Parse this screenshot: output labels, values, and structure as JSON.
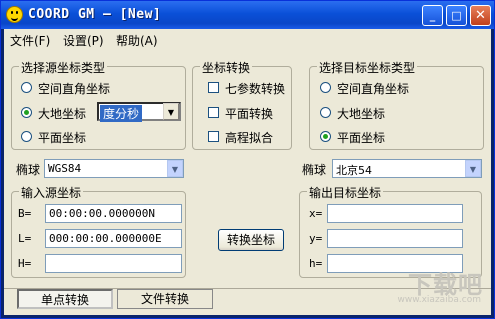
{
  "window": {
    "title": "COORD GM — [New]",
    "controls": {
      "minimize": "_",
      "maximize": "□",
      "close": "✕"
    }
  },
  "menu": [
    "文件(F)",
    "设置(P)",
    "帮助(A)"
  ],
  "source_type_group": {
    "title": "选择源坐标类型",
    "options": [
      "空间直角坐标",
      "大地坐标",
      "平面坐标"
    ],
    "selected": "大地坐标",
    "format_select": {
      "value": "度分秒"
    }
  },
  "transform_group": {
    "title": "坐标转换",
    "options": [
      "七参数转换",
      "平面转换",
      "高程拟合"
    ]
  },
  "target_type_group": {
    "title": "选择目标坐标类型",
    "options": [
      "空间直角坐标",
      "大地坐标",
      "平面坐标"
    ],
    "selected": "平面坐标"
  },
  "source_ellipsoid": {
    "label": "椭球",
    "value": "WGS84"
  },
  "target_ellipsoid": {
    "label": "椭球",
    "value": "北京54"
  },
  "input_group": {
    "title": "输入源坐标",
    "fields": [
      {
        "label": "B=",
        "value": "00:00:00.000000N"
      },
      {
        "label": "L=",
        "value": "000:00:00.000000E"
      },
      {
        "label": "H=",
        "value": ""
      }
    ]
  },
  "output_group": {
    "title": "输出目标坐标",
    "fields": [
      {
        "label": "x=",
        "value": ""
      },
      {
        "label": "y=",
        "value": ""
      },
      {
        "label": "h=",
        "value": ""
      }
    ]
  },
  "convert_button": "转换坐标",
  "mode_tabs": [
    "单点转换",
    "文件转换"
  ],
  "active_tab": "单点转换",
  "watermark": {
    "text": "下载吧",
    "sub": "www.xiazaiba.com"
  }
}
